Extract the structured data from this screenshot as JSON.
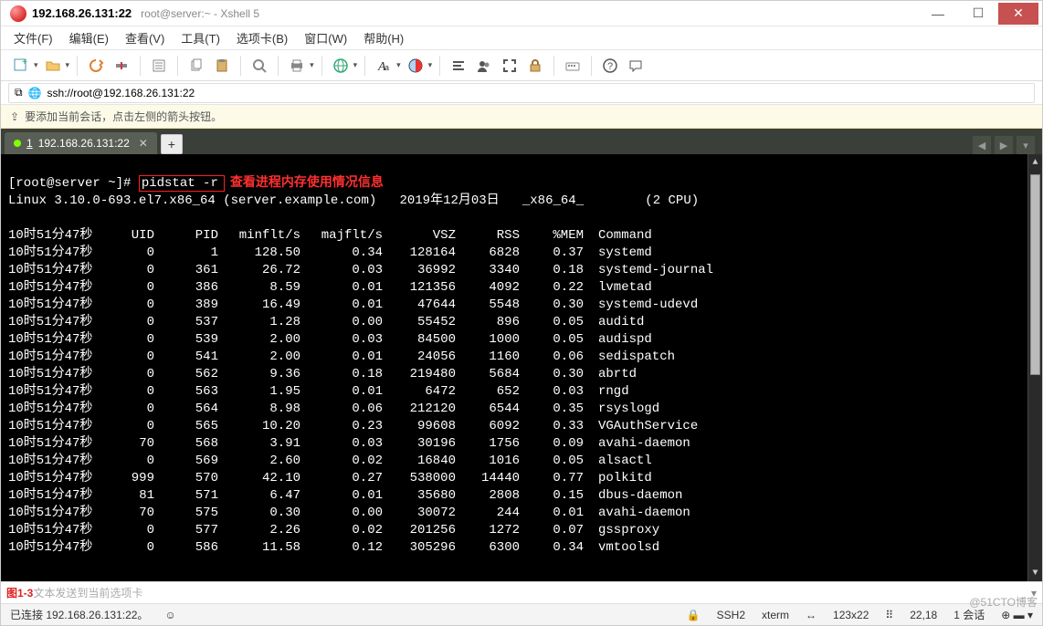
{
  "window": {
    "tab_title": "192.168.26.131:22",
    "sub_title": "root@server:~ - Xshell 5"
  },
  "menu": {
    "file": "文件(F)",
    "edit": "编辑(E)",
    "view": "查看(V)",
    "tools": "工具(T)",
    "tabs": "选项卡(B)",
    "window": "窗口(W)",
    "help": "帮助(H)"
  },
  "address": {
    "url": "ssh://root@192.168.26.131:22"
  },
  "hint": {
    "text": "要添加当前会话，点击左侧的箭头按钮。"
  },
  "session_tab": {
    "index": "1",
    "label": "192.168.26.131:22"
  },
  "prompt": "[root@server ~]# ",
  "command": "pidstat -r",
  "annotation": "查看进程内存使用情况信息",
  "sysline": {
    "kernel": "Linux 3.10.0-693.el7.x86_64 (server.example.com)",
    "date": "2019年12月03日",
    "arch": "_x86_64_",
    "cpu": "(2 CPU)"
  },
  "headers": {
    "time": "10时51分47秒",
    "uid": "UID",
    "pid": "PID",
    "min": "minflt/s",
    "maj": "majflt/s",
    "vsz": "VSZ",
    "rss": "RSS",
    "mem": "%MEM",
    "cmd": "Command"
  },
  "rows": [
    {
      "time": "10时51分47秒",
      "uid": "0",
      "pid": "1",
      "min": "128.50",
      "maj": "0.34",
      "vsz": "128164",
      "rss": "6828",
      "mem": "0.37",
      "cmd": "systemd"
    },
    {
      "time": "10时51分47秒",
      "uid": "0",
      "pid": "361",
      "min": "26.72",
      "maj": "0.03",
      "vsz": "36992",
      "rss": "3340",
      "mem": "0.18",
      "cmd": "systemd-journal"
    },
    {
      "time": "10时51分47秒",
      "uid": "0",
      "pid": "386",
      "min": "8.59",
      "maj": "0.01",
      "vsz": "121356",
      "rss": "4092",
      "mem": "0.22",
      "cmd": "lvmetad"
    },
    {
      "time": "10时51分47秒",
      "uid": "0",
      "pid": "389",
      "min": "16.49",
      "maj": "0.01",
      "vsz": "47644",
      "rss": "5548",
      "mem": "0.30",
      "cmd": "systemd-udevd"
    },
    {
      "time": "10时51分47秒",
      "uid": "0",
      "pid": "537",
      "min": "1.28",
      "maj": "0.00",
      "vsz": "55452",
      "rss": "896",
      "mem": "0.05",
      "cmd": "auditd"
    },
    {
      "time": "10时51分47秒",
      "uid": "0",
      "pid": "539",
      "min": "2.00",
      "maj": "0.03",
      "vsz": "84500",
      "rss": "1000",
      "mem": "0.05",
      "cmd": "audispd"
    },
    {
      "time": "10时51分47秒",
      "uid": "0",
      "pid": "541",
      "min": "2.00",
      "maj": "0.01",
      "vsz": "24056",
      "rss": "1160",
      "mem": "0.06",
      "cmd": "sedispatch"
    },
    {
      "time": "10时51分47秒",
      "uid": "0",
      "pid": "562",
      "min": "9.36",
      "maj": "0.18",
      "vsz": "219480",
      "rss": "5684",
      "mem": "0.30",
      "cmd": "abrtd"
    },
    {
      "time": "10时51分47秒",
      "uid": "0",
      "pid": "563",
      "min": "1.95",
      "maj": "0.01",
      "vsz": "6472",
      "rss": "652",
      "mem": "0.03",
      "cmd": "rngd"
    },
    {
      "time": "10时51分47秒",
      "uid": "0",
      "pid": "564",
      "min": "8.98",
      "maj": "0.06",
      "vsz": "212120",
      "rss": "6544",
      "mem": "0.35",
      "cmd": "rsyslogd"
    },
    {
      "time": "10时51分47秒",
      "uid": "0",
      "pid": "565",
      "min": "10.20",
      "maj": "0.23",
      "vsz": "99608",
      "rss": "6092",
      "mem": "0.33",
      "cmd": "VGAuthService"
    },
    {
      "time": "10时51分47秒",
      "uid": "70",
      "pid": "568",
      "min": "3.91",
      "maj": "0.03",
      "vsz": "30196",
      "rss": "1756",
      "mem": "0.09",
      "cmd": "avahi-daemon"
    },
    {
      "time": "10时51分47秒",
      "uid": "0",
      "pid": "569",
      "min": "2.60",
      "maj": "0.02",
      "vsz": "16840",
      "rss": "1016",
      "mem": "0.05",
      "cmd": "alsactl"
    },
    {
      "time": "10时51分47秒",
      "uid": "999",
      "pid": "570",
      "min": "42.10",
      "maj": "0.27",
      "vsz": "538000",
      "rss": "14440",
      "mem": "0.77",
      "cmd": "polkitd"
    },
    {
      "time": "10时51分47秒",
      "uid": "81",
      "pid": "571",
      "min": "6.47",
      "maj": "0.01",
      "vsz": "35680",
      "rss": "2808",
      "mem": "0.15",
      "cmd": "dbus-daemon"
    },
    {
      "time": "10时51分47秒",
      "uid": "70",
      "pid": "575",
      "min": "0.30",
      "maj": "0.00",
      "vsz": "30072",
      "rss": "244",
      "mem": "0.01",
      "cmd": "avahi-daemon"
    },
    {
      "time": "10时51分47秒",
      "uid": "0",
      "pid": "577",
      "min": "2.26",
      "maj": "0.02",
      "vsz": "201256",
      "rss": "1272",
      "mem": "0.07",
      "cmd": "gssproxy"
    },
    {
      "time": "10时51分47秒",
      "uid": "0",
      "pid": "586",
      "min": "11.58",
      "maj": "0.12",
      "vsz": "305296",
      "rss": "6300",
      "mem": "0.34",
      "cmd": "vmtoolsd"
    }
  ],
  "sendbar": {
    "fig": "图1-3",
    "hint": "文本发送到当前选项卡"
  },
  "status": {
    "connected": "已连接 192.168.26.131:22。",
    "ssh": "SSH2",
    "term": "xterm",
    "size": "123x22",
    "pos": "22,18",
    "sess": "1 会话"
  },
  "watermark": "@51CTO博客"
}
